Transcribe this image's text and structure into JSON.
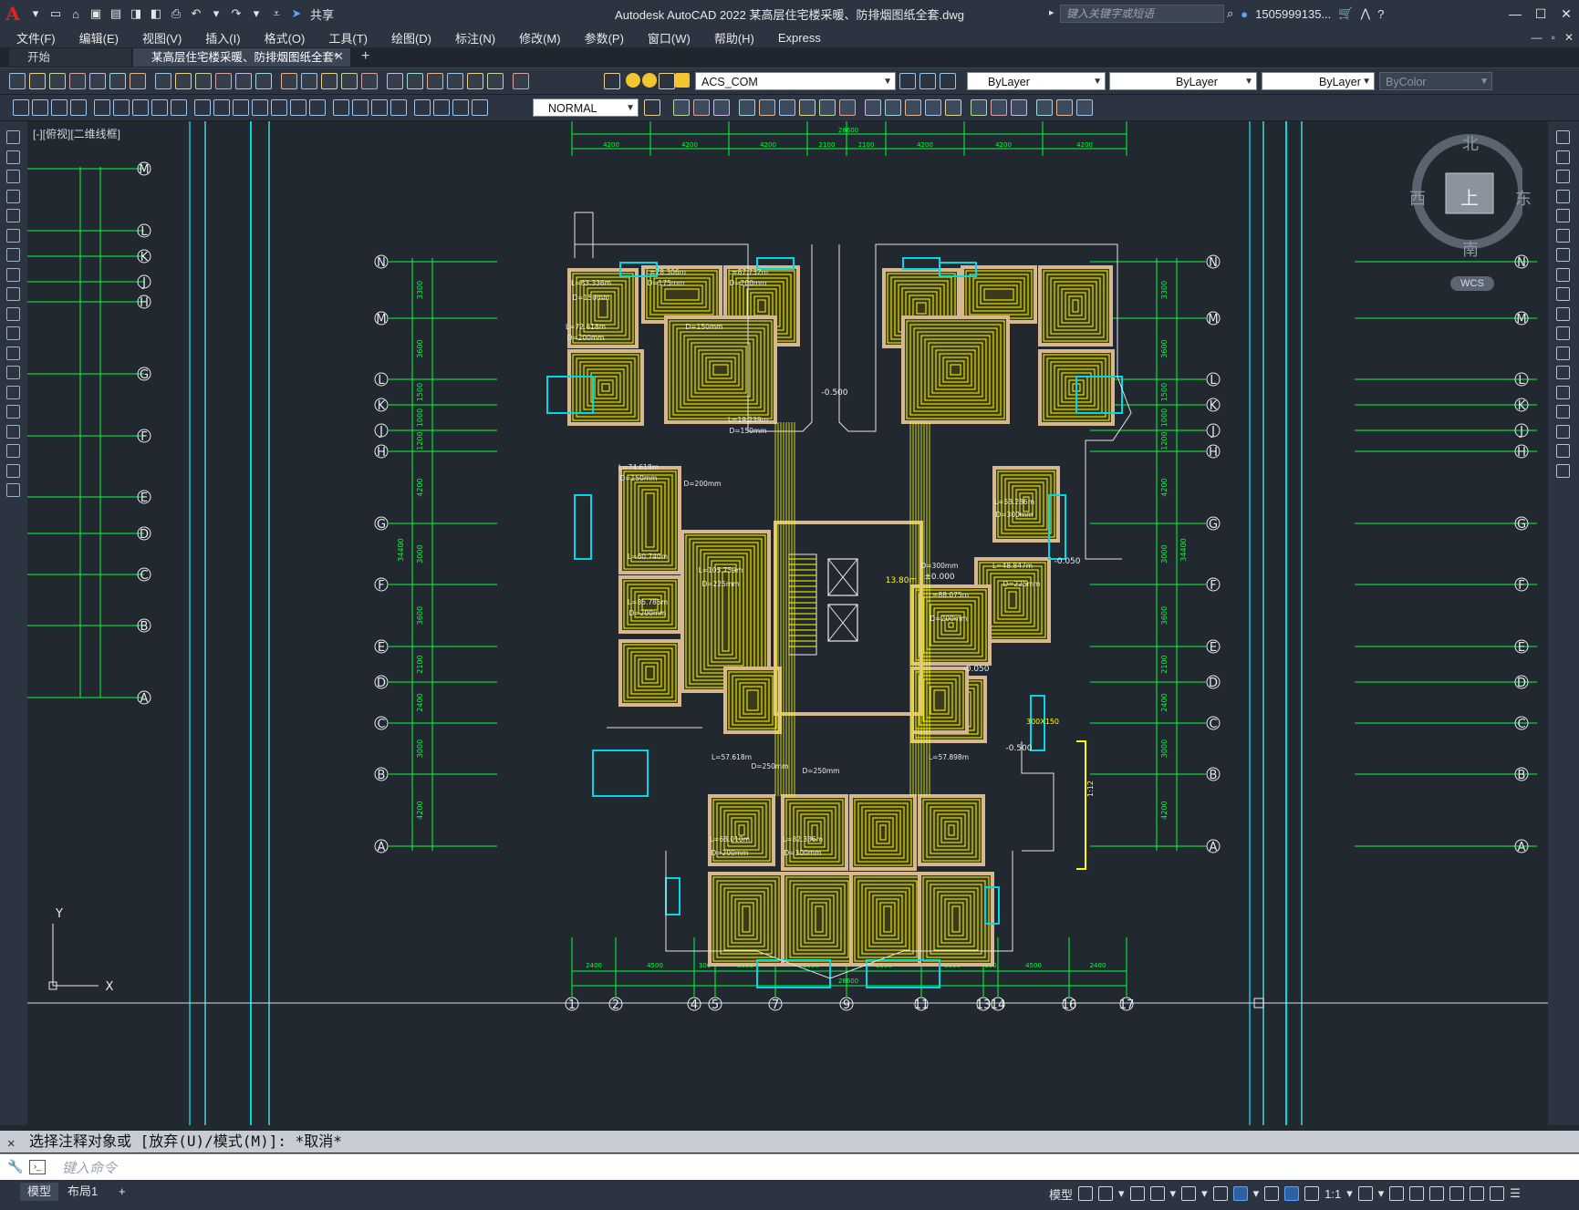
{
  "app": {
    "logo": "A",
    "title": "Autodesk AutoCAD 2022    某高层住宅楼采暖、防排烟图纸全套.dwg",
    "share_label": "共享",
    "search_placeholder": "键入关键字或短语",
    "user_label": "1505999135...",
    "window_controls": [
      "—",
      "☐",
      "✕"
    ]
  },
  "menu": {
    "items": [
      "文件(F)",
      "编辑(E)",
      "视图(V)",
      "插入(I)",
      "格式(O)",
      "工具(T)",
      "绘图(D)",
      "标注(N)",
      "修改(M)",
      "参数(P)",
      "窗口(W)",
      "帮助(H)",
      "Express"
    ],
    "doc_controls": [
      "—",
      "▫",
      "✕"
    ]
  },
  "tabs": {
    "start": "开始",
    "doc": "某高层住宅楼采暖、防排烟图纸全套*",
    "close": "✕",
    "add": "+"
  },
  "toolbar1": {
    "layer_combo": "ACS_COM",
    "color_combo": "ByLayer",
    "linetype_combo": "ByLayer",
    "lineweight_combo": "ByLayer",
    "plotstyle_combo": "ByColor"
  },
  "toolbar2": {
    "dimstyle_combo": "NORMAL"
  },
  "viewport": {
    "label": "[-][俯视][二维线框]"
  },
  "viewcube": {
    "north": "北",
    "south": "南",
    "east": "东",
    "west": "西",
    "face": "上",
    "wcs": "WCS"
  },
  "drawing": {
    "grid_rows_outer": [
      "N",
      "M",
      "L",
      "K",
      "J",
      "H",
      "G",
      "F",
      "E",
      "D",
      "C",
      "B",
      "A"
    ],
    "grid_cols_bottom": [
      "1",
      "2",
      "4",
      "5",
      "7",
      "9",
      "11",
      "13",
      "14",
      "16",
      "17"
    ],
    "top_dims": [
      "28600",
      "4200",
      "4200",
      "4200",
      "2100",
      "2100",
      "4200",
      "4200",
      "4200"
    ],
    "bottom_dims": [
      "2400",
      "4500",
      "300",
      "3600",
      "3900",
      "3900",
      "3600",
      "300",
      "4500",
      "2400",
      "28600"
    ],
    "left_dims": [
      "3300",
      "3600",
      "1500",
      "1000",
      "1200",
      "4200",
      "3000",
      "3600",
      "2100",
      "2400",
      "3000",
      "4200"
    ],
    "total_height_dim": "34400",
    "elevations": [
      "-0.500",
      "-0.050",
      "-0.500",
      "±0.000",
      "-0.050"
    ],
    "floor_note": "13.80m",
    "heating_labels": [
      "L=83.336m",
      "D=150mm",
      "L=78.306m",
      "D=175mm",
      "L=87.732m",
      "D=200mm",
      "L=72.818m",
      "D=200mm",
      "D=150mm",
      "L=19.239m",
      "D=150mm",
      "L=74.618m",
      "D=150mm",
      "D=200mm",
      "L=60.740m",
      "L=85.785m",
      "D=200mm",
      "L=105.759m",
      "D=225mm",
      "D=300mm",
      "L=88.075m",
      "D=200mm",
      "L=53.286m",
      "D=300mm",
      "L=48.847m",
      "D=225mm",
      "L=57.618m",
      "D=250mm",
      "L=68.010m",
      "D=200mm",
      "L=82.386m",
      "D=300mm",
      "D=250mm",
      "L=57.898m"
    ],
    "ucs_x": "X",
    "ucs_y": "Y",
    "duct_note": "300X150",
    "ratio": "1:12"
  },
  "command": {
    "history": "选择注释对象或 [放弃(U)/模式(M)]: *取消*",
    "placeholder": "键入命令"
  },
  "status": {
    "model_tab": "模型",
    "layout1_tab": "布局1",
    "add_tab": "+",
    "model_label": "模型",
    "scale": "1:1"
  },
  "colors": {
    "background": "#212830",
    "grid_line": "#00ff3a",
    "wall_fill": "#d6b78e",
    "heating_pipe": "#ffff00",
    "cyan": "#00d8e6",
    "title_accent": "#e8211c"
  }
}
